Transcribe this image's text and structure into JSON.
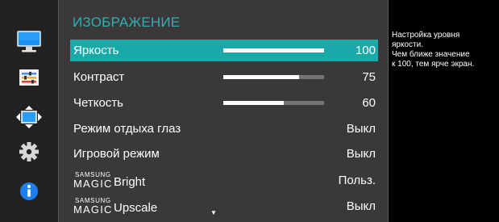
{
  "sidebar": {
    "items": [
      {
        "icon": "monitor-icon",
        "accent": "#1a8ff0"
      },
      {
        "icon": "color-settings-icon",
        "accent": "#4a90e2"
      },
      {
        "icon": "screen-size-icon",
        "accent": "#2a9df4"
      },
      {
        "icon": "gear-icon",
        "accent": "#d8d8d8"
      },
      {
        "icon": "info-icon",
        "accent": "#1e7ff0"
      }
    ]
  },
  "menu": {
    "title": "ИЗОБРАЖЕНИЕ",
    "items": [
      {
        "label": "Яркость",
        "value": "100",
        "level": 100
      },
      {
        "label": "Контраст",
        "value": "75",
        "level": 75
      },
      {
        "label": "Четкость",
        "value": "60",
        "level": 60
      },
      {
        "label": "Режим отдыха глаз",
        "value": "Выкл"
      },
      {
        "label": "Игровой режим",
        "value": "Выкл"
      },
      {
        "brand_top": "SAMSUNG",
        "brand_bottom": "MAGIC",
        "label": "Bright",
        "value": "Польз."
      },
      {
        "brand_top": "SAMSUNG",
        "brand_bottom": "MAGIC",
        "label": "Upscale",
        "value": "Выкл"
      }
    ],
    "scroll_indicator": "▼"
  },
  "help": {
    "lines": [
      "Настройка уровня",
      "яркости.",
      "Чем ближе значение",
      "к 100, тем ярче экран."
    ]
  },
  "colors": {
    "accent": "#19a9a9",
    "title": "#2bb3b3",
    "panel": "#3a3838",
    "sidebar": "#232222"
  }
}
